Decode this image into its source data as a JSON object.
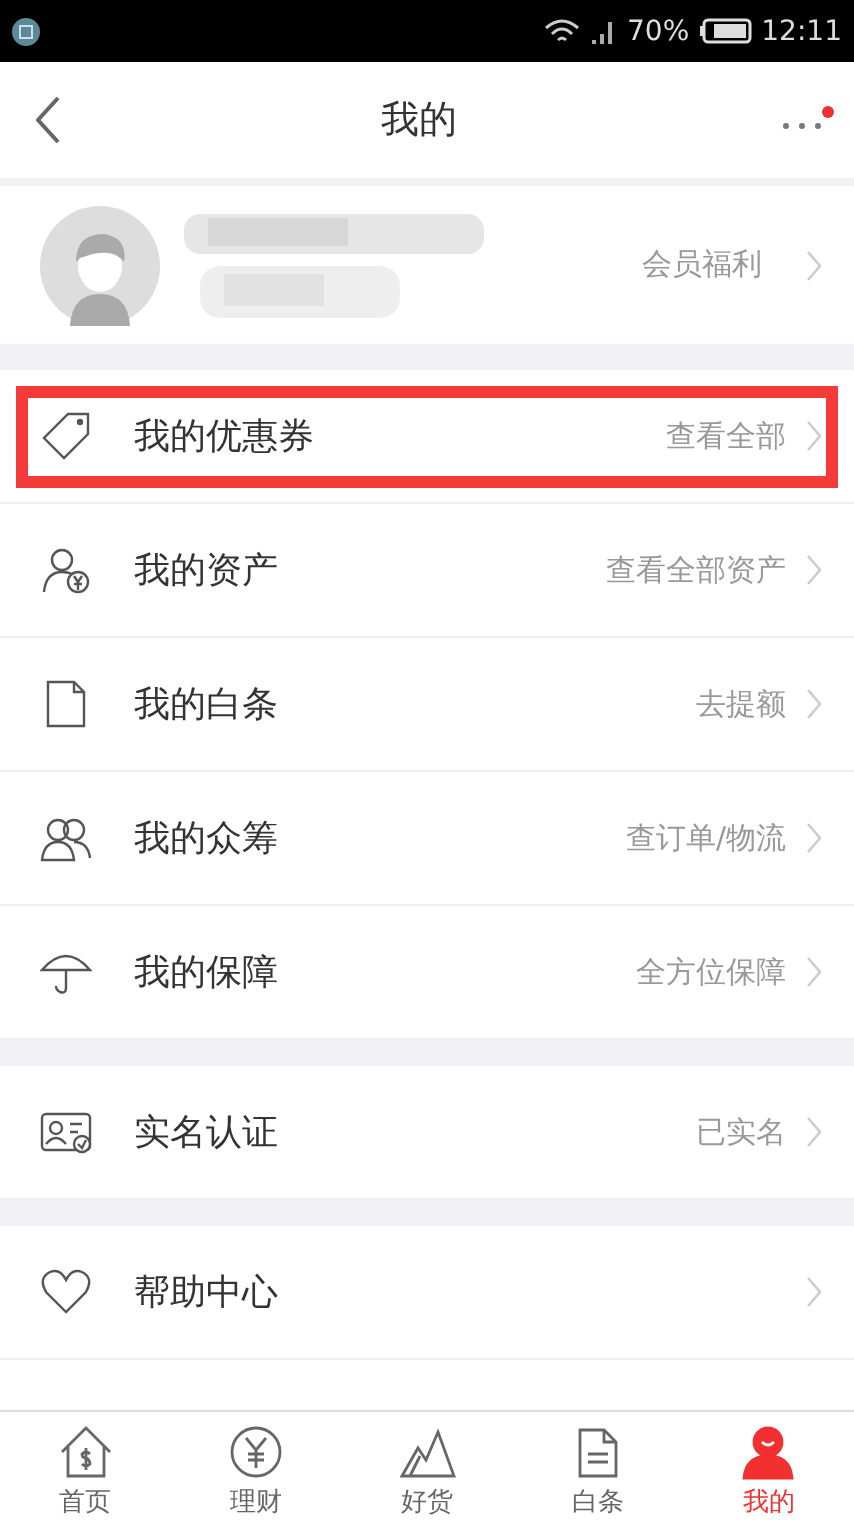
{
  "status_bar": {
    "battery": "70%",
    "time": "12:11"
  },
  "header": {
    "title": "我的",
    "has_notification": true
  },
  "profile": {
    "action": "会员福利"
  },
  "sections": [
    {
      "items": [
        {
          "label": "我的优惠券",
          "detail": "查看全部",
          "highlighted": true
        },
        {
          "label": "我的资产",
          "detail": "查看全部资产",
          "highlighted": false
        },
        {
          "label": "我的白条",
          "detail": "去提额",
          "highlighted": false
        },
        {
          "label": "我的众筹",
          "detail": "查订单/物流",
          "highlighted": false
        },
        {
          "label": "我的保障",
          "detail": "全方位保障",
          "highlighted": false
        }
      ]
    },
    {
      "items": [
        {
          "label": "实名认证",
          "detail": "已实名",
          "highlighted": false
        }
      ]
    },
    {
      "items": [
        {
          "label": "帮助中心",
          "highlighted": false
        }
      ]
    }
  ],
  "tabs": [
    {
      "label": "首页",
      "selected": false
    },
    {
      "label": "理财",
      "selected": false
    },
    {
      "label": "好货",
      "selected": false
    },
    {
      "label": "白条",
      "selected": false
    },
    {
      "label": "我的",
      "selected": true
    }
  ]
}
